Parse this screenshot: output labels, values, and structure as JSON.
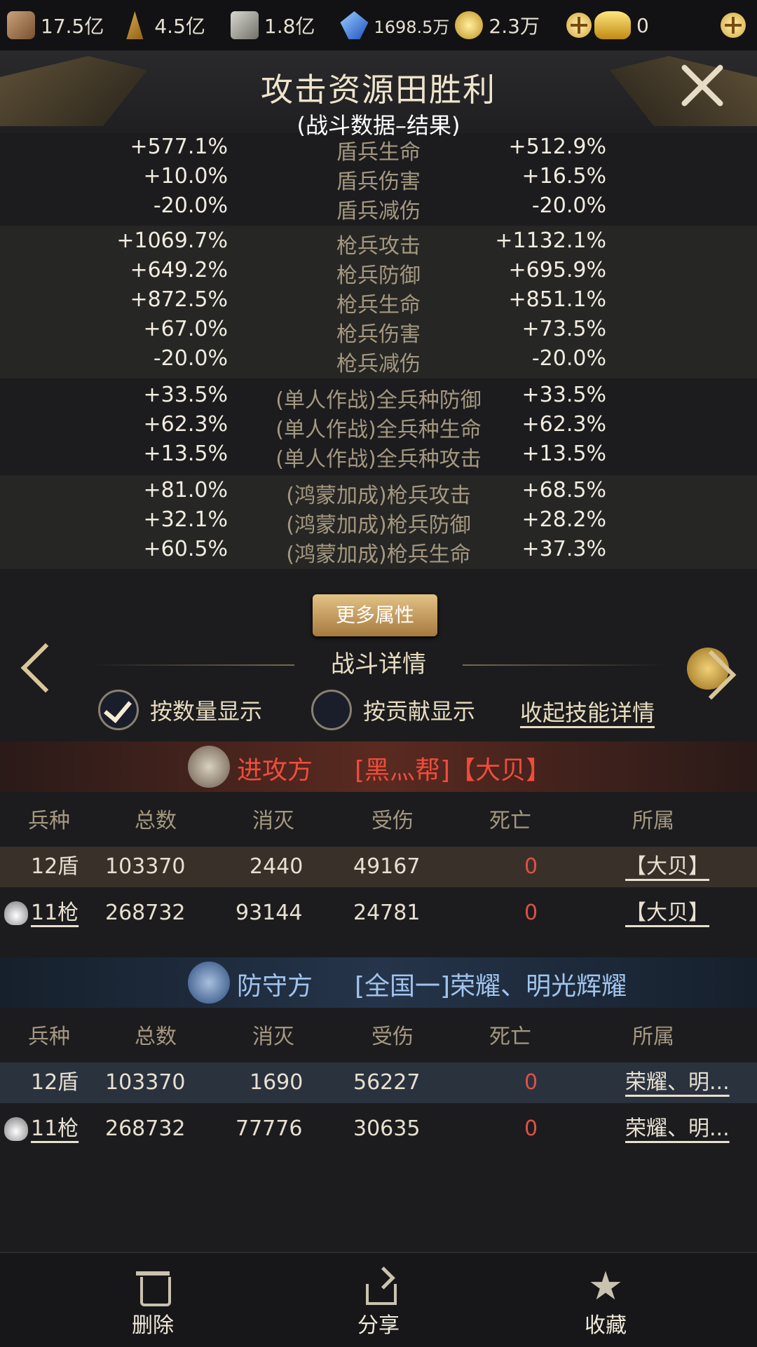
{
  "resources": [
    {
      "icon": "wood-icon",
      "value": "17.5亿"
    },
    {
      "icon": "food-icon",
      "value": "4.5亿"
    },
    {
      "icon": "stone-icon",
      "value": "1.8亿"
    },
    {
      "icon": "crystal-icon",
      "value": "1698.5万"
    },
    {
      "icon": "coin-icon",
      "value": "2.3万"
    },
    {
      "icon": "gold-ingot-icon",
      "value": "0"
    }
  ],
  "header": {
    "title": "攻击资源田胜利",
    "subtitle": "(战斗数据–结果)"
  },
  "stat_groups": [
    [
      {
        "left": "+577.1%",
        "label": "盾兵生命",
        "right": "+512.9%"
      },
      {
        "left": "+10.0%",
        "label": "盾兵伤害",
        "right": "+16.5%"
      },
      {
        "left": "-20.0%",
        "label": "盾兵减伤",
        "right": "-20.0%"
      }
    ],
    [
      {
        "left": "+1069.7%",
        "label": "枪兵攻击",
        "right": "+1132.1%"
      },
      {
        "left": "+649.2%",
        "label": "枪兵防御",
        "right": "+695.9%"
      },
      {
        "left": "+872.5%",
        "label": "枪兵生命",
        "right": "+851.1%"
      },
      {
        "left": "+67.0%",
        "label": "枪兵伤害",
        "right": "+73.5%"
      },
      {
        "left": "-20.0%",
        "label": "枪兵减伤",
        "right": "-20.0%"
      }
    ],
    [
      {
        "left": "+33.5%",
        "label": "(单人作战)全兵种防御",
        "right": "+33.5%"
      },
      {
        "left": "+62.3%",
        "label": "(单人作战)全兵种生命",
        "right": "+62.3%"
      },
      {
        "left": "+13.5%",
        "label": "(单人作战)全兵种攻击",
        "right": "+13.5%"
      }
    ],
    [
      {
        "left": "+81.0%",
        "label": "(鸿蒙加成)枪兵攻击",
        "right": "+68.5%"
      },
      {
        "left": "+32.1%",
        "label": "(鸿蒙加成)枪兵防御",
        "right": "+28.2%"
      },
      {
        "left": "+60.5%",
        "label": "(鸿蒙加成)枪兵生命",
        "right": "+37.3%"
      }
    ]
  ],
  "more_button": "更多属性",
  "detail": {
    "title": "战斗详情",
    "option_count": "按数量显示",
    "option_contrib": "按贡献显示",
    "collapse": "收起技能详情"
  },
  "columns": [
    "兵种",
    "总数",
    "消灭",
    "受伤",
    "死亡",
    "所属"
  ],
  "attacker": {
    "label": "进攻方",
    "name": "[黑灬帮]【大贝】",
    "rows": [
      {
        "type": "12盾",
        "total": "103370",
        "kill": "2440",
        "hurt": "49167",
        "dead": "0",
        "owner": "【大贝】"
      },
      {
        "type": "11枪",
        "total": "268732",
        "kill": "93144",
        "hurt": "24781",
        "dead": "0",
        "owner": "【大贝】"
      }
    ]
  },
  "defender": {
    "label": "防守方",
    "name": "[全国一]荣耀、明光辉耀",
    "rows": [
      {
        "type": "12盾",
        "total": "103370",
        "kill": "1690",
        "hurt": "56227",
        "dead": "0",
        "owner": "荣耀、明..."
      },
      {
        "type": "11枪",
        "total": "268732",
        "kill": "77776",
        "hurt": "30635",
        "dead": "0",
        "owner": "荣耀、明..."
      }
    ]
  },
  "bottom": {
    "delete": "删除",
    "share": "分享",
    "favorite": "收藏"
  }
}
